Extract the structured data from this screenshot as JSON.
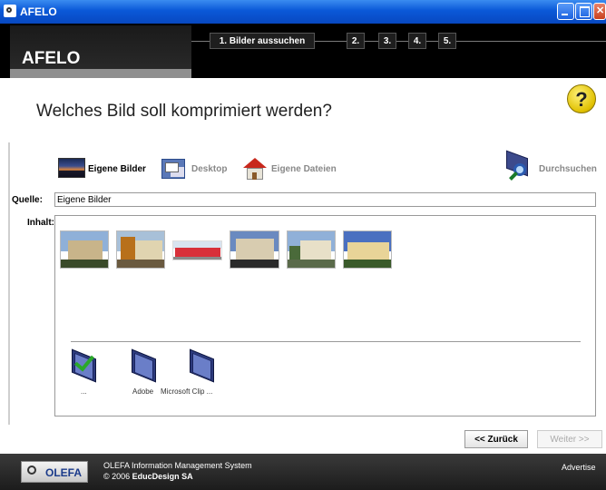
{
  "window": {
    "title": "AFELO"
  },
  "header": {
    "logo": "AFELO",
    "steps": [
      {
        "label": "1. Bilder aussuchen",
        "active": true
      },
      {
        "label": "2.",
        "active": false
      },
      {
        "label": "3.",
        "active": false
      },
      {
        "label": "4.",
        "active": false
      },
      {
        "label": "5.",
        "active": false
      }
    ]
  },
  "main": {
    "title": "Welches Bild soll komprimiert werden?",
    "help_icon_text": "?",
    "locations": [
      {
        "label": "Eigene Bilder",
        "icon": "sunset-icon",
        "selected": true
      },
      {
        "label": "Desktop",
        "icon": "desktop-icon",
        "selected": false
      },
      {
        "label": "Eigene Dateien",
        "icon": "house-icon",
        "selected": false
      }
    ],
    "browse_label": "Durchsuchen",
    "quelle_label": "Quelle:",
    "quelle_value": "Eigene Bilder",
    "inhalt_label": "Inhalt:",
    "thumbnails": [
      {
        "name": "building-photo-1"
      },
      {
        "name": "building-photo-2"
      },
      {
        "name": "building-photo-3"
      },
      {
        "name": "building-photo-4"
      },
      {
        "name": "building-photo-5"
      },
      {
        "name": "building-photo-6"
      }
    ],
    "folders": [
      {
        "label": "...",
        "icon": "folder-check-icon"
      },
      {
        "label": "Adobe",
        "icon": "folder-icon"
      },
      {
        "label": "Microsoft Clip ...",
        "icon": "folder-icon"
      }
    ]
  },
  "nav": {
    "back_label": "<< Zurück",
    "next_label": "Weiter >>"
  },
  "footer": {
    "logo_text": "OLEFA",
    "line1": "OLEFA Information Management System",
    "line2_prefix": "© 2006 ",
    "line2_company": "EducDesign SA",
    "advertise": "Advertise"
  },
  "colors": {
    "titlebar": "#0a58d8",
    "header": "#000000",
    "footer": "#2a2a2a",
    "help": "#f0d020"
  }
}
